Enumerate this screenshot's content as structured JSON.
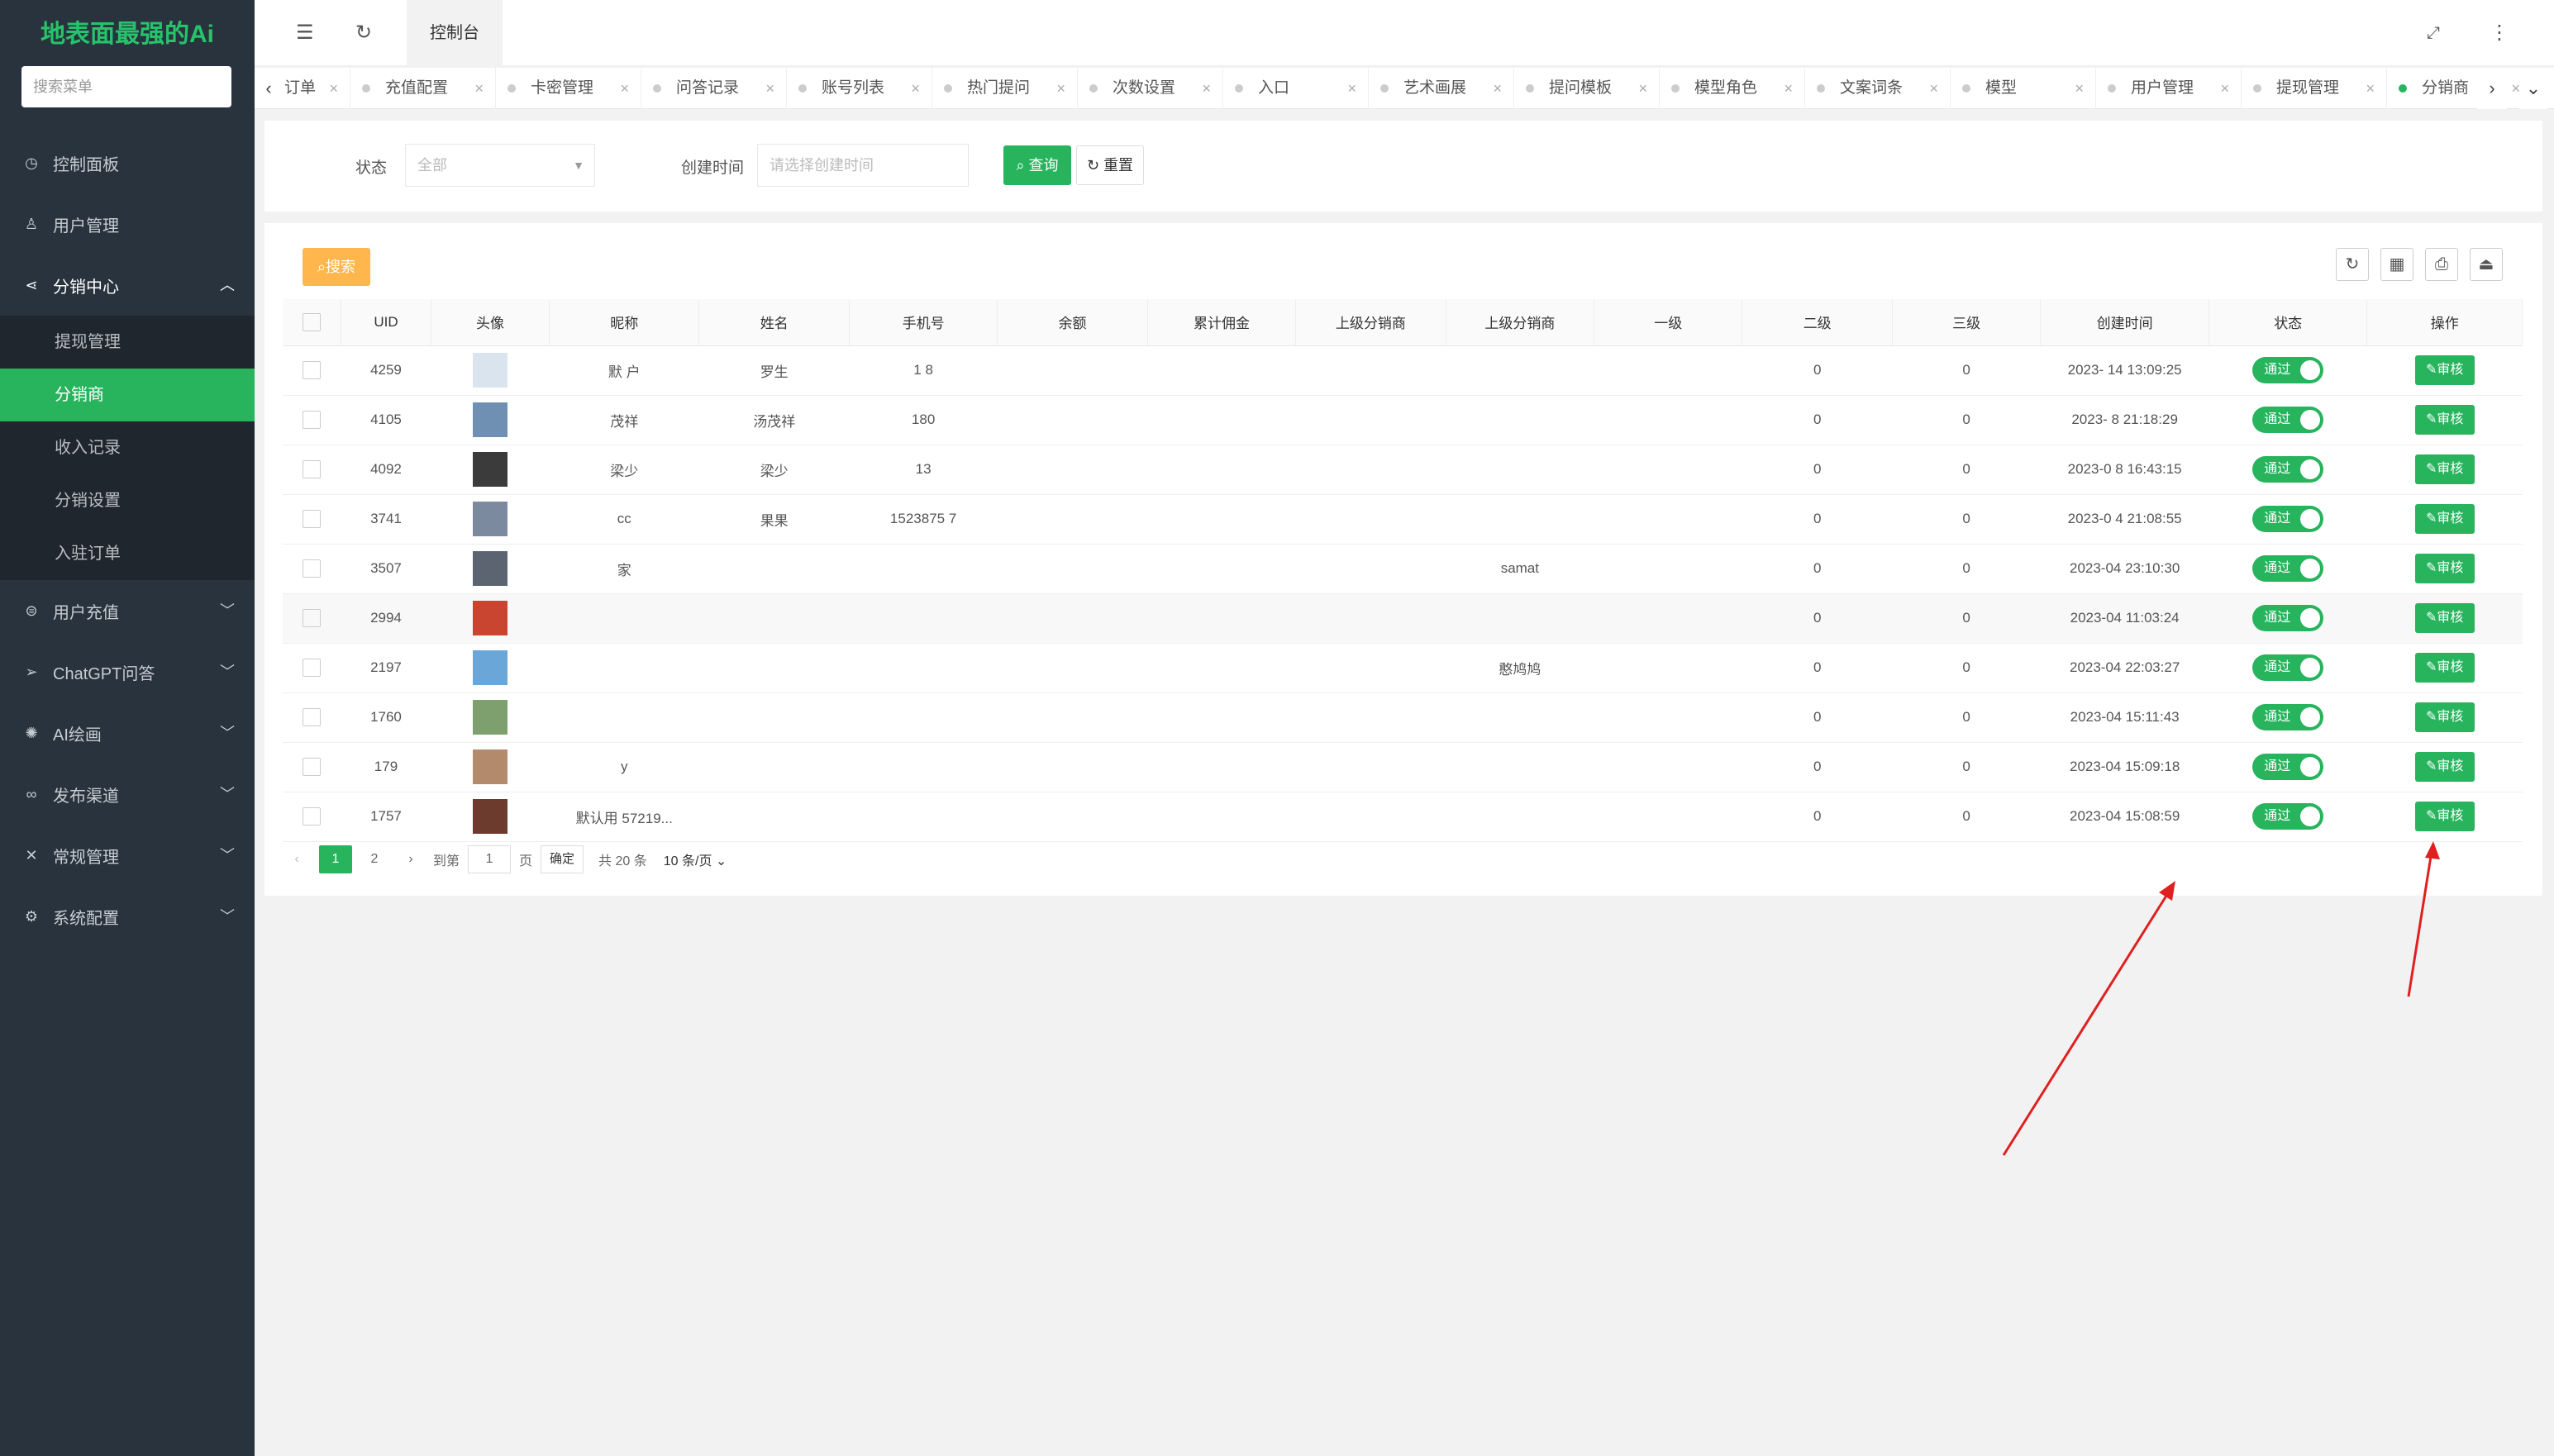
{
  "app": {
    "title": "地表面最强的Ai"
  },
  "sidebar": {
    "search_placeholder": "搜索菜单",
    "items": [
      {
        "label": "控制面板",
        "icon": "dashboard-icon"
      },
      {
        "label": "用户管理",
        "icon": "user-icon"
      },
      {
        "label": "分销中心",
        "icon": "share-icon"
      },
      {
        "label": "用户充值",
        "icon": "wallet-icon"
      },
      {
        "label": "ChatGPT问答",
        "icon": "send-icon"
      },
      {
        "label": "AI绘画",
        "icon": "palette-icon"
      },
      {
        "label": "发布渠道",
        "icon": "link-icon"
      },
      {
        "label": "常规管理",
        "icon": "tools-icon"
      },
      {
        "label": "系统配置",
        "icon": "gear-icon"
      }
    ],
    "submenu": [
      "提现管理",
      "分销商",
      "收入记录",
      "分销设置",
      "入驻订单"
    ]
  },
  "topbar": {
    "home_tab": "控制台"
  },
  "tabs": [
    "订单",
    "充值配置",
    "卡密管理",
    "问答记录",
    "账号列表",
    "热门提问",
    "次数设置",
    "入口",
    "艺术画展",
    "提问模板",
    "模型角色",
    "文案词条",
    "模型",
    "用户管理",
    "提现管理",
    "分销商"
  ],
  "filter": {
    "status_label": "状态",
    "status_value": "全部",
    "time_label": "创建时间",
    "time_placeholder": "请选择创建时间",
    "query_button": "查询",
    "reset_button": "重置"
  },
  "table": {
    "search_button": "搜索",
    "headers": [
      "UID",
      "头像",
      "昵称",
      "姓名",
      "手机号",
      "余额",
      "累计佣金",
      "上级分销商",
      "上级分销商",
      "一级",
      "二级",
      "三级",
      "创建时间",
      "状态",
      "操作"
    ],
    "rows": [
      {
        "uid": "4259",
        "nick": "默  户",
        "name": "罗生",
        "phone": "1        8",
        "parent": "",
        "l2": "0",
        "l3": "0",
        "time": "2023-  14 13:09:25",
        "status": "通过",
        "action": "审核"
      },
      {
        "uid": "4105",
        "nick": "茂祥",
        "name": "汤茂祥",
        "phone": "180",
        "parent": "",
        "l2": "0",
        "l3": "0",
        "time": "2023-  8 21:18:29",
        "status": "通过",
        "action": "审核"
      },
      {
        "uid": "4092",
        "nick": "梁少",
        "name": "梁少",
        "phone": "13",
        "parent": "",
        "l2": "0",
        "l3": "0",
        "time": "2023-0  8 16:43:15",
        "status": "通过",
        "action": "审核"
      },
      {
        "uid": "3741",
        "nick": "cc",
        "name": "果果",
        "phone": "1523875  7",
        "parent": "",
        "l2": "0",
        "l3": "0",
        "time": "2023-0  4 21:08:55",
        "status": "通过",
        "action": "审核"
      },
      {
        "uid": "3507",
        "nick": "家",
        "name": "",
        "phone": "",
        "parent": "samat",
        "l2": "0",
        "l3": "0",
        "time": "2023-04  23:10:30",
        "status": "通过",
        "action": "审核"
      },
      {
        "uid": "2994",
        "nick": "",
        "name": "",
        "phone": "",
        "parent": "",
        "l2": "0",
        "l3": "0",
        "time": "2023-04  11:03:24",
        "status": "通过",
        "action": "审核"
      },
      {
        "uid": "2197",
        "nick": "",
        "name": "",
        "phone": "",
        "parent": "憨鸠鸠",
        "l2": "0",
        "l3": "0",
        "time": "2023-04  22:03:27",
        "status": "通过",
        "action": "审核"
      },
      {
        "uid": "1760",
        "nick": "",
        "name": "",
        "phone": "",
        "parent": "",
        "l2": "0",
        "l3": "0",
        "time": "2023-04  15:11:43",
        "status": "通过",
        "action": "审核"
      },
      {
        "uid": "179",
        "nick": "y",
        "name": "",
        "phone": "",
        "parent": "",
        "l2": "0",
        "l3": "0",
        "time": "2023-04  15:09:18",
        "status": "通过",
        "action": "审核"
      },
      {
        "uid": "1757",
        "nick": "默认用  57219...",
        "name": "",
        "phone": "",
        "parent": "",
        "l2": "0",
        "l3": "0",
        "time": "2023-04  15:08:59",
        "status": "通过",
        "action": "审核"
      }
    ]
  },
  "pager": {
    "pages": [
      "1",
      "2"
    ],
    "goto_label": "到第",
    "goto_value": "1",
    "page_unit": "页",
    "confirm": "确定",
    "total": "共 20 条",
    "size": "10 条/页"
  },
  "colors": {
    "accent": "#27b45d",
    "sidebar": "#28333e",
    "logo": "#27c36b",
    "search_btn": "#ffb64d",
    "arrow": "#e02020"
  }
}
